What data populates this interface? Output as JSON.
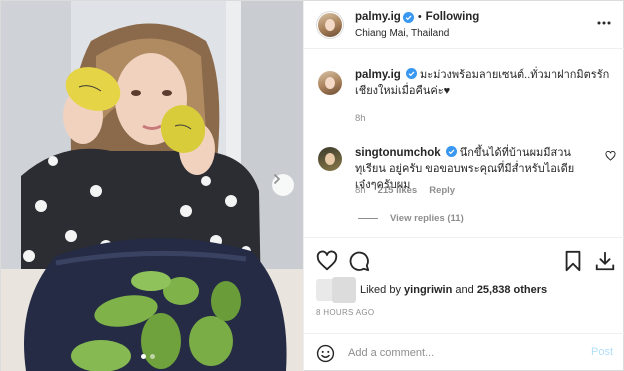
{
  "post": {
    "username": "palmy.ig",
    "follow_separator": "•",
    "follow_status": "Following",
    "location": "Chiang Mai, Thailand"
  },
  "caption": {
    "username": "palmy.ig",
    "text": "มะม่วงพร้อมลายเซนต์..ทั่วมาฝากมิตรรัก เชียงใหม่เมื่อคืนค่ะ♥",
    "age": "8h"
  },
  "comment": {
    "username": "singtonumchok",
    "text": "นึกขึ้นได้ที่บ้านผมมีสวนทุเรียน อยู่ครับ ขอขอบพระคุณที่มีส่ำหรับไอเดียเจ๋งๆครับผม",
    "age": "8h",
    "likes": "215 likes",
    "reply_label": "Reply",
    "view_replies": "View replies (11)"
  },
  "likes": {
    "prefix": "Liked by",
    "liker": "yingriwin",
    "conjunction": "and",
    "others": "25,838 others"
  },
  "timestamp": "8 HOURS AGO",
  "add_comment": {
    "placeholder": "Add a comment...",
    "post_label": "Post"
  },
  "icons": {
    "more": "more-options-icon",
    "like": "heart-icon",
    "comment": "comment-bubble-icon",
    "bookmark": "bookmark-icon",
    "download": "download-icon",
    "emoji": "emoji-smile-icon",
    "next": "chevron-right-icon"
  },
  "colors": {
    "verified": "#3897f0",
    "post_button": "#b2dffc",
    "secondary_text": "#8e8e8e"
  }
}
